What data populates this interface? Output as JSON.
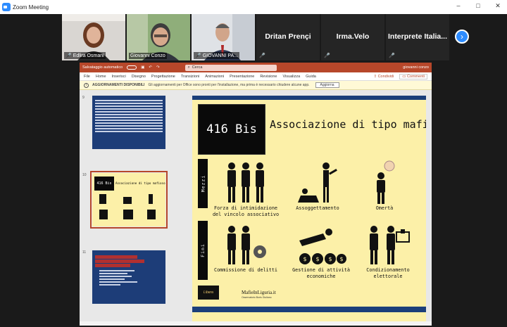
{
  "window": {
    "title": "Zoom Meeting",
    "controls": [
      "–",
      "□",
      "✕"
    ]
  },
  "participants": [
    {
      "name": "Edlira Osmani",
      "kind": "video",
      "muted": true,
      "active": false
    },
    {
      "name": "Giovanni Conzo",
      "kind": "video",
      "muted": false,
      "active": true
    },
    {
      "name": "GIOVANNI PA...",
      "kind": "video",
      "muted": true,
      "active": false
    },
    {
      "name": "Dritan Prençi",
      "kind": "text",
      "muted": true,
      "active": false
    },
    {
      "name": "Irma.Velo",
      "kind": "text",
      "muted": true,
      "active": false
    },
    {
      "name": "Interprete  Italia...",
      "kind": "text",
      "muted": true,
      "active": false
    }
  ],
  "ppt": {
    "autosave_label": "Salvataggio automatico",
    "search_placeholder": "Cerca",
    "user": "giovanni conzo",
    "ribbon_tabs": [
      "File",
      "Home",
      "Inserisci",
      "Disegno",
      "Progettazione",
      "Transizioni",
      "Animazioni",
      "Presentazione",
      "Revisione",
      "Visualizza",
      "Guida"
    ],
    "share_label": "Condividi",
    "comments_label": "Commenti",
    "info": {
      "title": "AGGIORNAMENTI DISPONIBILI",
      "message": "Gli aggiornamenti per Office sono pronti per l'installazione, ma prima è necessario chiudere alcune app.",
      "button": "Aggiorna"
    },
    "thumbs": [
      {
        "num": "9"
      },
      {
        "num": "10",
        "badge": "416 Bis",
        "title": "Associazione di tipo mafioso"
      },
      {
        "num": "11"
      }
    ],
    "slide": {
      "badge": "416 Bis",
      "title": "Associazione di tipo mafioso",
      "band_mezzi": "Mezzi",
      "band_fini": "Fini",
      "mezzi": [
        "Forza di intimidazione del vincolo associativo",
        "Assoggettamento",
        "Omertà"
      ],
      "fini": [
        "Commissione di delitti",
        "Gestione di attività economiche",
        "Condizionamento elettorale"
      ],
      "logo_text": "Libera",
      "site": "MafieInLiguria.it",
      "site_sub": "Osservatorio Boris Giuliano"
    }
  }
}
